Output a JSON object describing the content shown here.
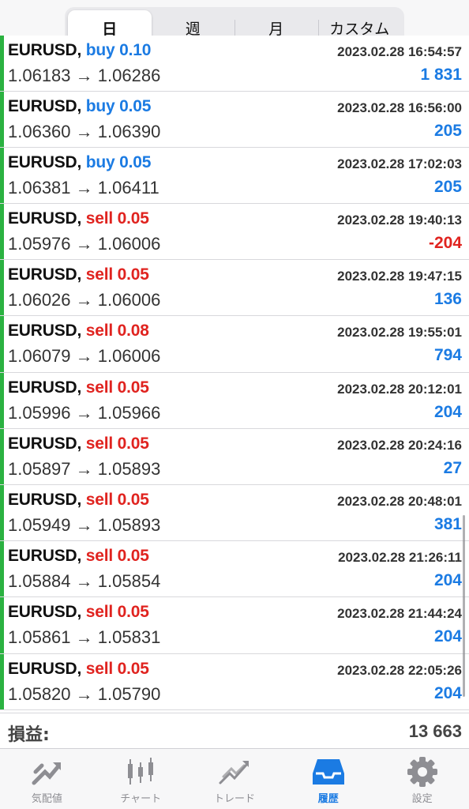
{
  "periods": {
    "tabs": [
      "日",
      "週",
      "月",
      "カスタム"
    ],
    "active": 0
  },
  "colors": {
    "buy": "#1b7be3",
    "sell": "#e0231f",
    "profit_positive": "#1b7be3",
    "profit_negative": "#e0231f",
    "row_bar": "#2bb241"
  },
  "trades": [
    {
      "symbol": "EURUSD,",
      "side": "buy",
      "volume": "0.10",
      "time": "2023.02.28 16:54:57",
      "open": "1.06183",
      "close": "1.06286",
      "profit": "1 831"
    },
    {
      "symbol": "EURUSD,",
      "side": "buy",
      "volume": "0.05",
      "time": "2023.02.28 16:56:00",
      "open": "1.06360",
      "close": "1.06390",
      "profit": "205"
    },
    {
      "symbol": "EURUSD,",
      "side": "buy",
      "volume": "0.05",
      "time": "2023.02.28 17:02:03",
      "open": "1.06381",
      "close": "1.06411",
      "profit": "205"
    },
    {
      "symbol": "EURUSD,",
      "side": "sell",
      "volume": "0.05",
      "time": "2023.02.28 19:40:13",
      "open": "1.05976",
      "close": "1.06006",
      "profit": "-204"
    },
    {
      "symbol": "EURUSD,",
      "side": "sell",
      "volume": "0.05",
      "time": "2023.02.28 19:47:15",
      "open": "1.06026",
      "close": "1.06006",
      "profit": "136"
    },
    {
      "symbol": "EURUSD,",
      "side": "sell",
      "volume": "0.08",
      "time": "2023.02.28 19:55:01",
      "open": "1.06079",
      "close": "1.06006",
      "profit": "794"
    },
    {
      "symbol": "EURUSD,",
      "side": "sell",
      "volume": "0.05",
      "time": "2023.02.28 20:12:01",
      "open": "1.05996",
      "close": "1.05966",
      "profit": "204"
    },
    {
      "symbol": "EURUSD,",
      "side": "sell",
      "volume": "0.05",
      "time": "2023.02.28 20:24:16",
      "open": "1.05897",
      "close": "1.05893",
      "profit": "27"
    },
    {
      "symbol": "EURUSD,",
      "side": "sell",
      "volume": "0.05",
      "time": "2023.02.28 20:48:01",
      "open": "1.05949",
      "close": "1.05893",
      "profit": "381"
    },
    {
      "symbol": "EURUSD,",
      "side": "sell",
      "volume": "0.05",
      "time": "2023.02.28 21:26:11",
      "open": "1.05884",
      "close": "1.05854",
      "profit": "204"
    },
    {
      "symbol": "EURUSD,",
      "side": "sell",
      "volume": "0.05",
      "time": "2023.02.28 21:44:24",
      "open": "1.05861",
      "close": "1.05831",
      "profit": "204"
    },
    {
      "symbol": "EURUSD,",
      "side": "sell",
      "volume": "0.05",
      "time": "2023.02.28 22:05:26",
      "open": "1.05820",
      "close": "1.05790",
      "profit": "204"
    }
  ],
  "arrow": "→",
  "summary": {
    "label": "損益:",
    "value": "13 663"
  },
  "tabbar": {
    "items": [
      {
        "label": "気配値",
        "icon": "quotes-icon"
      },
      {
        "label": "チャート",
        "icon": "chart-icon"
      },
      {
        "label": "トレード",
        "icon": "trade-icon"
      },
      {
        "label": "履歴",
        "icon": "history-icon"
      },
      {
        "label": "設定",
        "icon": "settings-icon"
      }
    ],
    "active": 3
  }
}
